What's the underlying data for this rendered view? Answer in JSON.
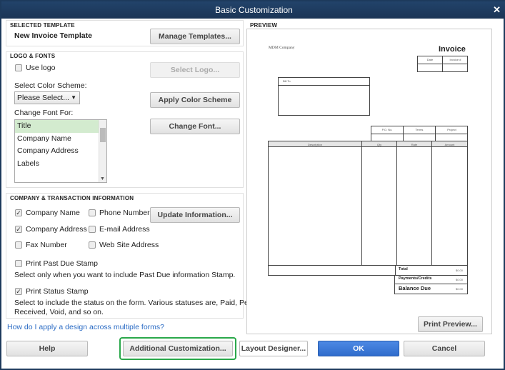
{
  "window": {
    "title": "Basic Customization",
    "close": "✕"
  },
  "selected_template": {
    "heading": "SELECTED TEMPLATE",
    "name": "New Invoice Template",
    "manage_button": "Manage Templates..."
  },
  "logo_fonts": {
    "heading": "LOGO & FONTS",
    "use_logo": "Use logo",
    "use_logo_checked": false,
    "select_logo_button": "Select Logo...",
    "color_scheme_label": "Select Color Scheme:",
    "color_scheme_value": "Please Select...",
    "apply_color_button": "Apply Color Scheme",
    "change_font_for_label": "Change Font For:",
    "font_items": [
      "Title",
      "Company Name",
      "Company Address",
      "Labels"
    ],
    "selected_font_item": "Title",
    "change_font_button": "Change Font..."
  },
  "company_info": {
    "heading": "COMPANY & TRANSACTION INFORMATION",
    "company_name": "Company Name",
    "phone_number": "Phone Number",
    "company_address": "Company Address",
    "email_address": "E-mail Address",
    "fax_number": "Fax Number",
    "web_site": "Web Site Address",
    "update_button": "Update Information...",
    "past_due_stamp": "Print Past Due Stamp",
    "past_due_help": "Select only when you want to include Past Due information Stamp.",
    "status_stamp": "Print Status Stamp",
    "status_help_1": "Select to include the status on the form. Various statuses are, Paid, Pending,",
    "status_help_2": "Received, Void, and so on."
  },
  "help_link": "How do I apply a design across multiple forms?",
  "preview": {
    "heading": "PREVIEW",
    "company": "MDM Company",
    "doc_title": "Invoice",
    "date": "Date",
    "invoice_no": "Invoice #",
    "bill_to": "Bill To",
    "po": "P.O. No.",
    "terms": "Terms",
    "project": "Project",
    "description": "Description",
    "qty": "Qty",
    "rate": "Rate",
    "amount": "Amount",
    "total": "Total",
    "payments": "Payments/Credits",
    "balance": "Balance Due",
    "zero": "$0.00",
    "print_preview_button": "Print Preview..."
  },
  "footer": {
    "help": "Help",
    "additional": "Additional Customization...",
    "layout": "Layout Designer...",
    "ok": "OK",
    "cancel": "Cancel"
  },
  "colors": {
    "titlebar": "#1d3a5c",
    "ok": "#3b78d8",
    "highlight": "#2aa84a",
    "selection": "#d3ebcf"
  }
}
